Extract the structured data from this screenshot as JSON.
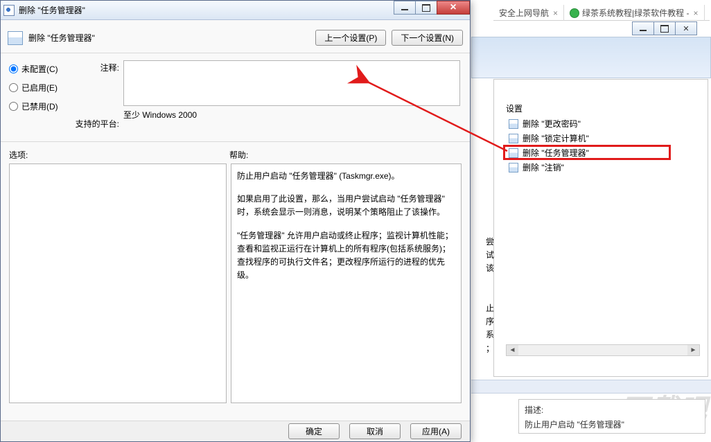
{
  "dialog": {
    "title": "删除 \"任务管理器\"",
    "header_title": "删除 \"任务管理器\"",
    "prev_btn": "上一个设置(P)",
    "next_btn": "下一个设置(N)",
    "radios": {
      "not_configured": "未配置(C)",
      "enabled": "已启用(E)",
      "disabled": "已禁用(D)"
    },
    "labels": {
      "comment": "注释:",
      "platform": "支持的平台:",
      "options": "选项:",
      "help": "帮助:"
    },
    "platform_value": "至少 Windows 2000",
    "help_p1": "防止用户启动 \"任务管理器\" (Taskmgr.exe)。",
    "help_p2": "如果启用了此设置，那么，当用户尝试启动 \"任务管理器\" 时，系统会显示一则消息，说明某个策略阻止了该操作。",
    "help_p3": "\"任务管理器\" 允许用户启动或终止程序；监视计算机性能；查看和监视正运行在计算机上的所有程序(包括系统服务)；查找程序的可执行文件名；更改程序所运行的进程的优先级。",
    "footer": {
      "ok": "确定",
      "cancel": "取消",
      "apply": "应用(A)"
    }
  },
  "bg": {
    "tab1": "安全上网导航",
    "tab2": "绿茶系统教程|绿茶软件教程 -",
    "settings_heading": "设置",
    "items": [
      "删除 \"更改密码\"",
      "删除 \"锁定计算机\"",
      "删除 \"任务管理器\"",
      "删除 \"注销\""
    ],
    "side_chars": [
      "尝",
      "试",
      "该",
      "",
      "",
      "止",
      "序",
      "系",
      "；"
    ],
    "desc_label": "描述:",
    "desc_line": "防止用户启动 \"任务管理器\""
  },
  "watermark": "下载吧"
}
